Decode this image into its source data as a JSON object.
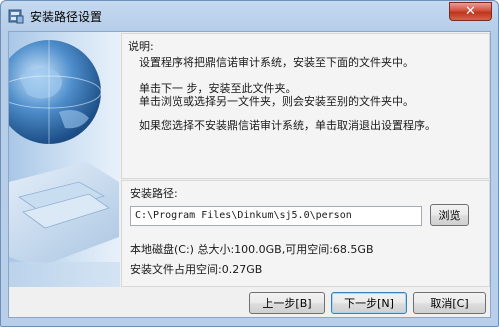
{
  "window": {
    "title": "安装路径设置",
    "close_glyph": "✕"
  },
  "info": {
    "heading": "说明:",
    "line1": "设置程序将把鼎信诺审计系统，安装至下面的文件夹中。",
    "line2": "单击下一 步，安装至此文件夹。",
    "line3": "单击浏览或选择另一文件夹，则会安装至别的文件夹中。",
    "line4": "如果您选择不安装鼎信诺审计系统，单击取消退出设置程序。"
  },
  "install": {
    "path_label": "安装路径:",
    "path_value": "C:\\Program Files\\Dinkum\\sj5.0\\person",
    "browse_label": "浏览",
    "disk_info": "本地磁盘(C:) 总大小:100.0GB,可用空间:68.5GB",
    "space_required": "安装文件占用空间:0.27GB"
  },
  "buttons": {
    "back": "上一步[B]",
    "next": "下一步[N]",
    "cancel": "取消[C]"
  },
  "colors": {
    "accent": "#3c7fb1",
    "close": "#c0341d"
  },
  "icons": {
    "app": "installer-app-icon",
    "close": "close-icon",
    "art": "globe-laptop-illustration"
  }
}
